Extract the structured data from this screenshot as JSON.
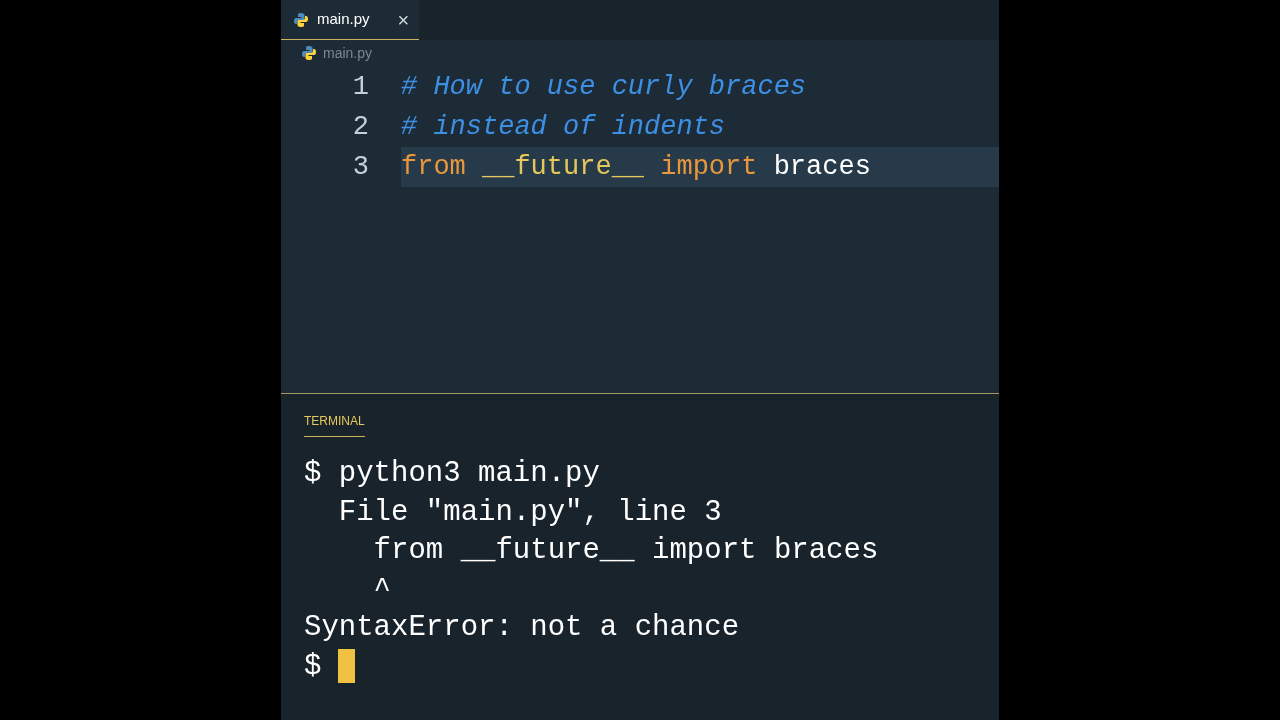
{
  "tabs": [
    {
      "label": "main.py",
      "selected": true,
      "close": "×"
    }
  ],
  "breadcrumb": "main.py",
  "editor": {
    "lines": [
      {
        "number": "1",
        "current": false,
        "tokens": [
          {
            "kind": "comment",
            "text": "# How to use curly braces"
          }
        ]
      },
      {
        "number": "2",
        "current": false,
        "tokens": [
          {
            "kind": "comment",
            "text": "# instead of indents"
          }
        ]
      },
      {
        "number": "3",
        "current": true,
        "tokens": [
          {
            "kind": "keyword",
            "text": "from"
          },
          {
            "kind": "dunder",
            "text": " __future__"
          },
          {
            "kind": "keyword",
            "text": " import"
          },
          {
            "kind": "plain",
            "text": " braces"
          }
        ]
      }
    ]
  },
  "terminal": {
    "title": "TERMINAL",
    "lines": [
      "$ python3 main.py",
      "  File \"main.py\", line 3",
      "    from __future__ import braces",
      "    ^",
      "SyntaxError: not a chance"
    ],
    "prompt": "$"
  }
}
